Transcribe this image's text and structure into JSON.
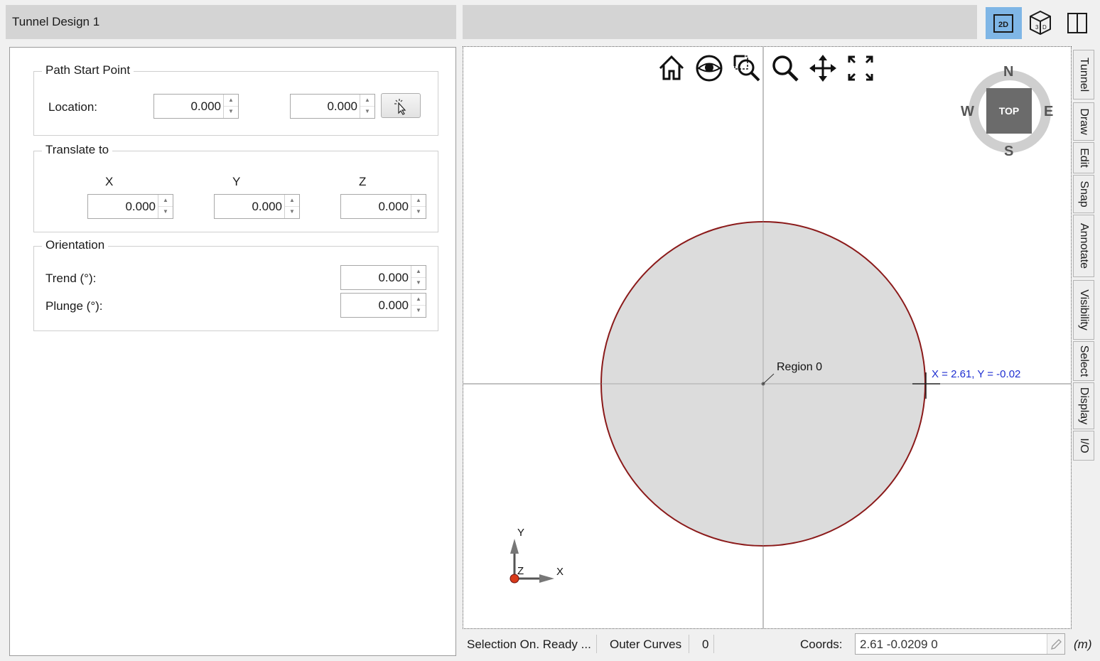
{
  "left_header": {
    "title": "Tunnel Design 1"
  },
  "path_start_point": {
    "legend": "Path Start Point",
    "location_label": "Location:",
    "location_a": "0.000",
    "location_b": "0.000",
    "pick_icon": "cursor-pick-icon"
  },
  "translate_to": {
    "legend": "Translate to",
    "x_label": "X",
    "y_label": "Y",
    "z_label": "Z",
    "x_value": "0.000",
    "y_value": "0.000",
    "z_value": "0.000"
  },
  "orientation": {
    "legend": "Orientation",
    "trend_label": "Trend (°):",
    "trend_value": "0.000",
    "plunge_label": "Plunge (°):",
    "plunge_value": "0.000"
  },
  "toolbar": {
    "btn_2d": "2D",
    "btn_2d_active": true,
    "icons": [
      "2d-view-icon",
      "3d-view-icon",
      "split-view-icon"
    ]
  },
  "viewport_tools": [
    "home-icon",
    "eye-icon",
    "zoom-window-icon",
    "zoom-icon",
    "pan-icon",
    "fit-extents-icon"
  ],
  "compass": {
    "n": "N",
    "s": "S",
    "e": "E",
    "w": "W",
    "top": "TOP"
  },
  "canvas": {
    "region_label": "Region 0",
    "cursor_readout": "X = 2.61, Y = -0.02",
    "circle_stroke": "#8b1a1a",
    "circle_fill": "#dcdcdc",
    "readout_color": "#1f2fd1"
  },
  "axis_triad": {
    "x": "X",
    "y": "Y",
    "z": "Z"
  },
  "side_tabs": [
    "Tunnel",
    "Draw",
    "Edit",
    "Snap",
    "Annotate",
    "Visibility",
    "Select",
    "Display",
    "I/O"
  ],
  "status_bar": {
    "message": "Selection On. Ready ...",
    "outer_curves_label": "Outer Curves",
    "outer_curves_count": "0",
    "coords_label": "Coords:",
    "coords_value": "2.61 -0.0209 0",
    "units": "(m)"
  },
  "colors": {
    "accent_2d": "#7fb6e6",
    "header_gray": "#d4d4d4"
  }
}
